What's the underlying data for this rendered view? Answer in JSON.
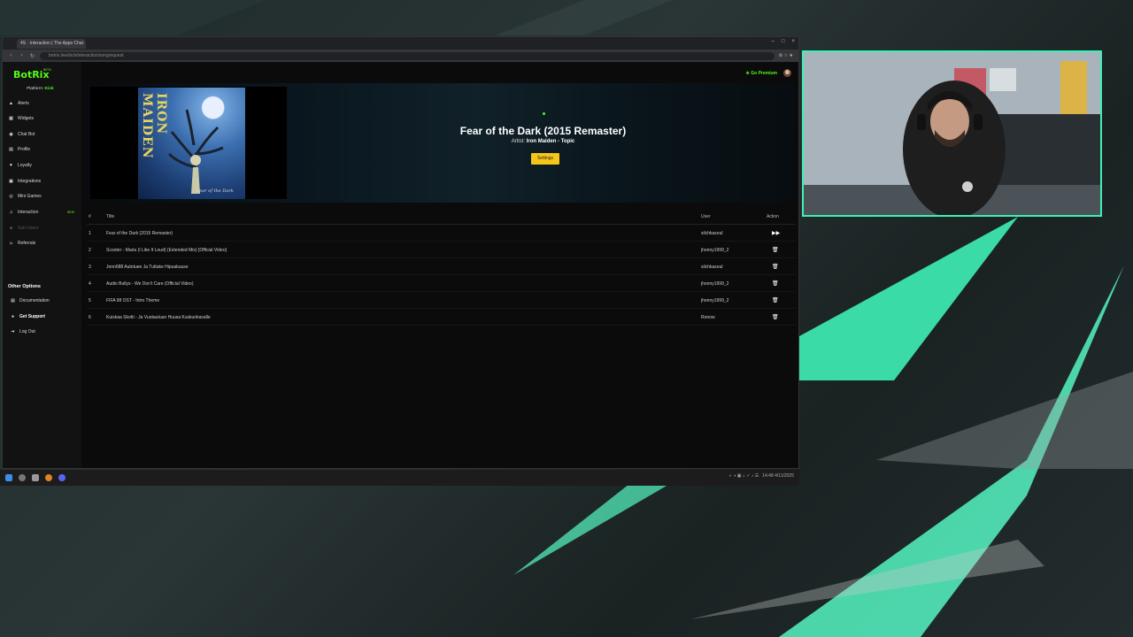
{
  "browser": {
    "tab_title": "4S · Interaction | The Apps Chat",
    "url": "botrix.live/kick/interaction/songrequest",
    "win_controls": [
      "–",
      "□",
      "×"
    ]
  },
  "sidebar": {
    "logo": "BotRix",
    "beta": "BETA",
    "platform_label": "Platform:",
    "platform_value": "Kick",
    "items": [
      {
        "label": "Alerts",
        "icon": "▲"
      },
      {
        "label": "Widgets",
        "icon": "▦"
      },
      {
        "label": "Chat Bot",
        "icon": "◉"
      },
      {
        "label": "Profile",
        "icon": "▤"
      },
      {
        "label": "Loyalty",
        "icon": "♥"
      },
      {
        "label": "Integrations",
        "icon": "▣"
      },
      {
        "label": "Mini Games",
        "icon": "◎"
      },
      {
        "label": "Interaction",
        "icon": "♫"
      },
      {
        "label": "Sub Users",
        "icon": "☻"
      },
      {
        "label": "Referrals",
        "icon": "☺"
      }
    ],
    "new_badge": "NEW",
    "other_heading": "Other Options",
    "other_items": [
      {
        "label": "Documentation",
        "icon": "▤"
      },
      {
        "label": "Get Support",
        "icon": "●"
      },
      {
        "label": "Log Out",
        "icon": "➔"
      }
    ]
  },
  "topbar": {
    "premium": "★ Go Premium"
  },
  "now_playing": {
    "title": "Fear of the Dark (2015 Remaster)",
    "artist_label": "Artist:",
    "artist": "Iron Maiden - Topic",
    "settings_button": "Settings",
    "cover_title": "IRON MAIDEN",
    "cover_subtitle": "Fear of the Dark"
  },
  "queue": {
    "headers": {
      "num": "#",
      "title": "Title",
      "user": "User",
      "action": "Action"
    },
    "rows": [
      {
        "num": "1",
        "title": "Fear of the Dark (2015 Remaster)",
        "user": "silchkasoul",
        "action": "▶▶"
      },
      {
        "num": "2",
        "title": "Scooter - Maria (I Like It Loud) (Extended Mix) [Official Video]",
        "user": "jhonny1999_2",
        "action": "🗑"
      },
      {
        "num": "3",
        "title": "Jonn688 Autotuee Ja Tuttuke Hipuakuuse",
        "user": "silchkasoul",
        "action": "🗑"
      },
      {
        "num": "4",
        "title": "Audio Bullys - We Don't Care (Official Video)",
        "user": "jhonny1999_2",
        "action": "🗑"
      },
      {
        "num": "5",
        "title": "FIFA 98 OST - Intro Theme",
        "user": "jhonny1999_2",
        "action": "🗑"
      },
      {
        "num": "6",
        "title": "Kuiskaa Skotti - Ja Vuotautuun Huusa Kuskunkavalle",
        "user": "Ronow",
        "action": "🗑"
      }
    ]
  },
  "taskbar": {
    "tray_time": "14:48",
    "tray_date": "4/11/2025"
  },
  "colors": {
    "accent": "#53fc18",
    "button": "#f5c518",
    "cam_border": "#3ef0b5"
  }
}
